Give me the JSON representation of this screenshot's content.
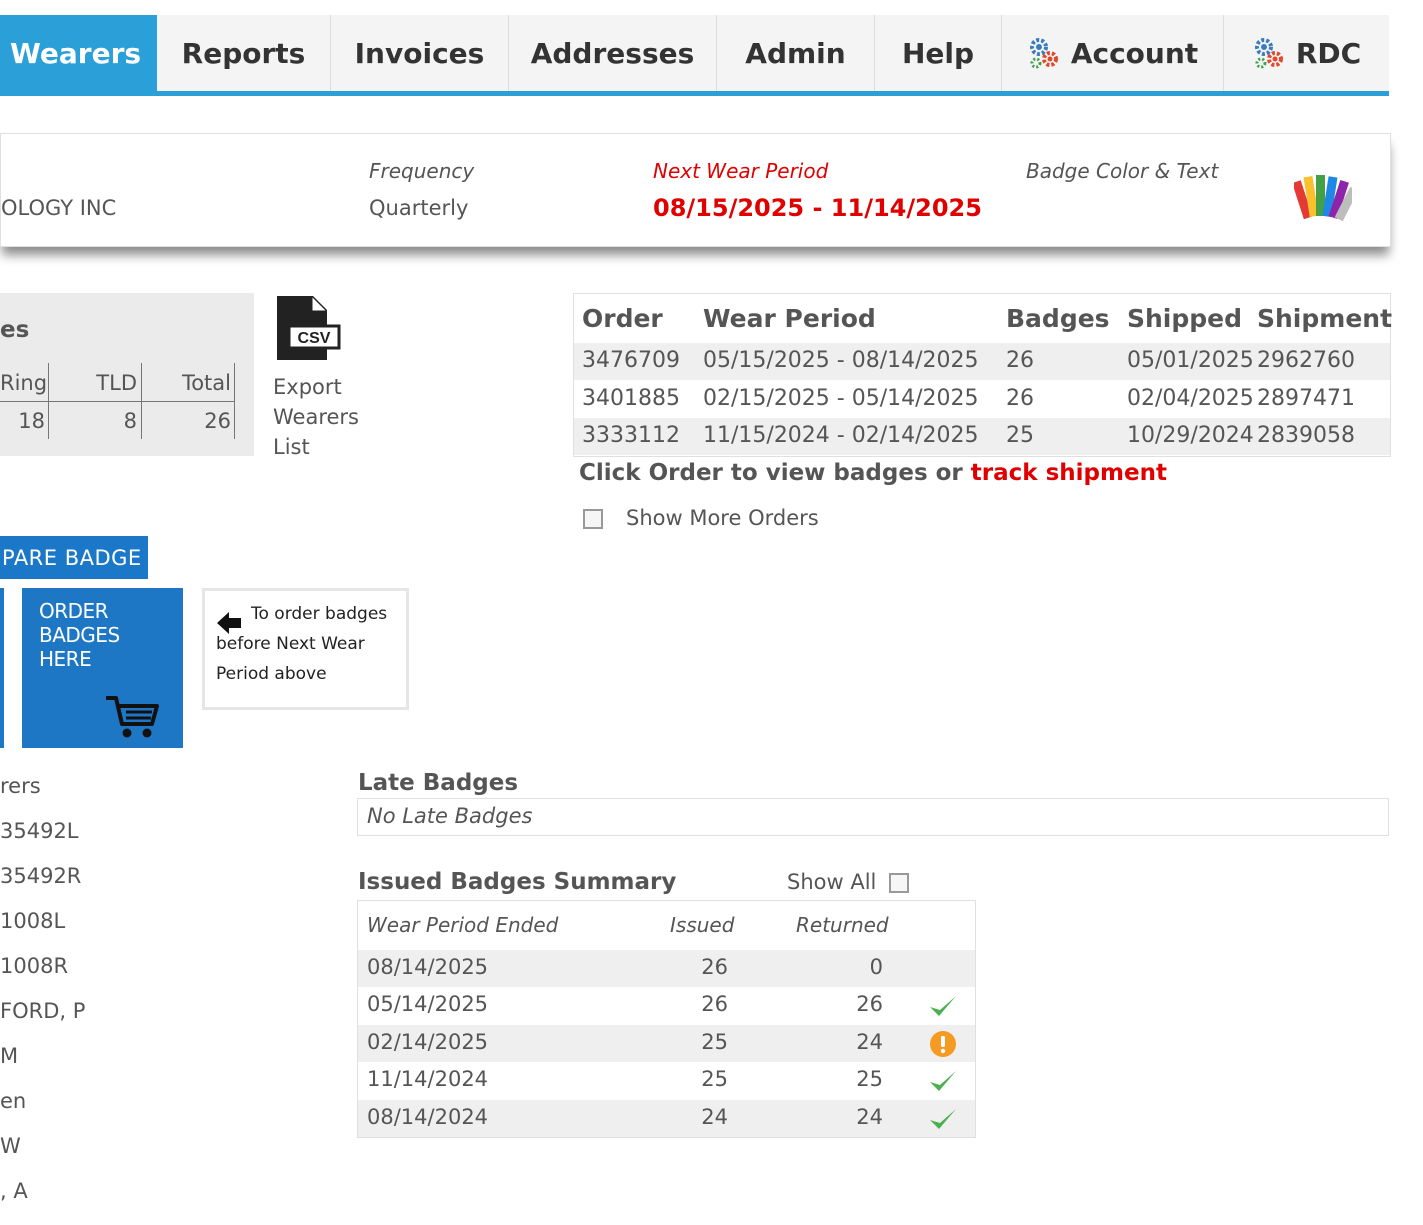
{
  "nav": {
    "tabs": [
      {
        "label": "Wearers",
        "active": true
      },
      {
        "label": "Reports"
      },
      {
        "label": "Invoices"
      },
      {
        "label": "Addresses"
      },
      {
        "label": "Admin"
      },
      {
        "label": "Help"
      },
      {
        "label": "Account",
        "icon": "gears-icon"
      },
      {
        "label": "RDC",
        "icon": "gears-icon"
      }
    ],
    "accent_color": "#2a9fd8"
  },
  "account_info": {
    "company_fragment": "OLOGY INC",
    "frequency_label": "Frequency",
    "frequency_value": "Quarterly",
    "next_wear_label": "Next Wear Period",
    "next_wear_value": "08/15/2025 - 11/14/2025",
    "badge_color_label": "Badge Color & Text",
    "badge_color_icon": "color-swatch-icon",
    "highlight_color": "#e00000"
  },
  "counts": {
    "title_fragment": "es",
    "headers": [
      "Ring",
      "TLD",
      "Total"
    ],
    "values": [
      "18",
      "8",
      "26"
    ]
  },
  "export": {
    "icon": "csv-file-icon",
    "icon_text": "CSV",
    "label_lines": [
      "Export",
      "Wearers",
      "List"
    ]
  },
  "orders": {
    "headers": [
      "Order",
      "Wear Period",
      "Badges",
      "Shipped",
      "Shipment"
    ],
    "rows": [
      {
        "order": "3476709",
        "wear_period": "05/15/2025 - 08/14/2025",
        "badges": "26",
        "shipped": "05/01/2025",
        "shipment": "2962760"
      },
      {
        "order": "3401885",
        "wear_period": "02/15/2025 - 05/14/2025",
        "badges": "26",
        "shipped": "02/04/2025",
        "shipment": "2897471"
      },
      {
        "order": "3333112",
        "wear_period": "11/15/2024 - 02/14/2025",
        "badges": "25",
        "shipped": "10/29/2024",
        "shipment": "2839058"
      }
    ],
    "hint_prefix": "Click Order to view badges or ",
    "hint_link": "track shipment",
    "show_more_label": "Show More Orders"
  },
  "actions": {
    "spare_badge_label": "PARE BADGE",
    "order_badges_label": "ORDER BADGES HERE",
    "order_note": "To order badges before Next Wear Period above",
    "button_color": "#1e77c4"
  },
  "wearers_list": [
    "rers",
    "35492L",
    "35492R",
    "1008L",
    "1008R",
    "FORD, P",
    "M",
    "en",
    "W",
    ", A"
  ],
  "late_badges": {
    "title": "Late Badges",
    "message": "No Late Badges"
  },
  "issued_summary": {
    "title": "Issued Badges Summary",
    "show_all_label": "Show All",
    "headers": [
      "Wear Period Ended",
      "Issued",
      "Returned"
    ],
    "rows": [
      {
        "ended": "08/14/2025",
        "issued": "26",
        "returned": "0",
        "status": "none"
      },
      {
        "ended": "05/14/2025",
        "issued": "26",
        "returned": "26",
        "status": "check-icon"
      },
      {
        "ended": "02/14/2025",
        "issued": "25",
        "returned": "24",
        "status": "warning-icon"
      },
      {
        "ended": "11/14/2024",
        "issued": "25",
        "returned": "25",
        "status": "check-icon"
      },
      {
        "ended": "08/14/2024",
        "issued": "24",
        "returned": "24",
        "status": "check-icon"
      }
    ]
  }
}
